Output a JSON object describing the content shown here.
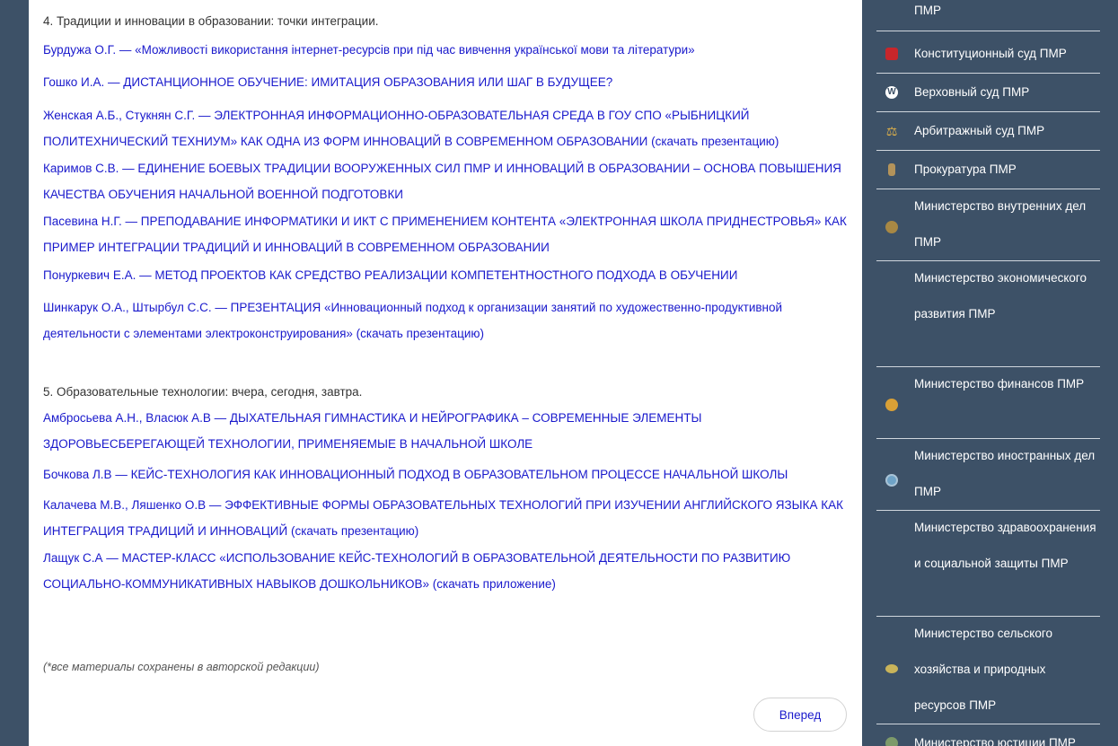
{
  "main": {
    "section4": {
      "heading": "4. Традиции и инновации в образовании: точки интеграции.",
      "links": [
        "Бурдужа О.Г. — «Можливості використання інтернет-ресурсів при під час вивчення української мови та літератури»",
        "Гошко И.А. — ДИСТАНЦИОННОЕ ОБУЧЕНИЕ: ИМИТАЦИЯ ОБРАЗОВАНИЯ ИЛИ ШАГ В БУДУЩЕЕ?",
        "Женская А.Б., Стукнян С.Г. — ЭЛЕКТРОННАЯ ИНФОРМАЦИОННО-ОБРАЗОВАТЕЛЬНАЯ СРЕДА В ГОУ СПО «РЫБНИЦКИЙ ПОЛИТЕХНИЧЕСКИЙ ТЕХНИУМ» КАК ОДНА ИЗ ФОРМ ИННОВАЦИЙ В СОВРЕМЕННОМ ОБРАЗОВАНИИ (скачать презентацию)",
        "Каримов С.В. — ЕДИНЕНИЕ БОЕВЫХ ТРАДИЦИИ ВООРУЖЕННЫХ СИЛ ПМР И ИННОВАЦИЙ В ОБРАЗОВАНИИ – ОСНОВА ПОВЫШЕНИЯ КАЧЕСТВА ОБУЧЕНИЯ НАЧАЛЬНОЙ ВОЕННОЙ ПОДГОТОВКИ",
        "Пасевина Н.Г. — ПРЕПОДАВАНИЕ ИНФОРМАТИКИ И ИКТ С ПРИМЕНЕНИЕМ КОНТЕНТА «ЭЛЕКТРОННАЯ ШКОЛА ПРИДНЕСТРОВЬЯ» КАК ПРИМЕР ИНТЕГРАЦИИ ТРАДИЦИЙ И ИННОВАЦИЙ В СОВРЕМЕННОМ ОБРАЗОВАНИИ",
        "Понуркевич Е.А. — МЕТОД ПРОЕКТОВ КАК СРЕДСТВО РЕАЛИЗАЦИИ КОМПЕТЕНТНОСТНОГО ПОДХОДА В ОБУЧЕНИИ",
        "Шинкарук О.А., Штырбул С.С. — ПРЕЗЕНТАЦИЯ «Инновационный подход к организации занятий по художественно-продуктивной деятельности с элементами электроконструирования» (скачать презентацию)"
      ]
    },
    "section5": {
      "heading": "5. Образовательные технологии: вчера, сегодня, завтра.",
      "links": [
        "Амбросьева А.Н., Власюк А.В — ДЫХАТЕЛЬНАЯ ГИМНАСТИКА И НЕЙРОГРАФИКА – СОВРЕМЕННЫЕ ЭЛЕМЕНТЫ ЗДОРОВЬЕСБЕРЕГАЮЩЕЙ ТЕХНОЛОГИИ, ПРИМЕНЯЕМЫЕ В НАЧАЛЬНОЙ ШКОЛЕ",
        "Бочкова Л.В — КЕЙС-ТЕХНОЛОГИЯ КАК ИННОВАЦИОННЫЙ ПОДХОД В ОБРАЗОВАТЕЛЬНОМ ПРОЦЕССЕ НАЧАЛЬНОЙ ШКОЛЫ",
        "Калачева М.В., Ляшенко О.В — ЭФФЕКТИВНЫЕ ФОРМЫ ОБРАЗОВАТЕЛЬНЫХ ТЕХНОЛОГИЙ ПРИ ИЗУЧЕНИИ АНГЛИЙСКОГО ЯЗЫКА КАК ИНТЕГРАЦИЯ ТРАДИЦИЙ И ИННОВАЦИЙ (скачать презентацию)",
        "Лащук С.А — МАСТЕР-КЛАСС «ИСПОЛЬЗОВАНИЕ КЕЙС-ТЕХНОЛОГИЙ В ОБРАЗОВАТЕЛЬНОЙ ДЕЯТЕЛЬНОСТИ ПО РАЗВИТИЮ СОЦИАЛЬНО-КОММУНИКАТИВНЫХ НАВЫКОВ ДОШКОЛЬНИКОВ» (скачать приложение)"
      ]
    },
    "note": "(*все материалы сохранены в авторской редакции)",
    "next_button": "Вперед"
  },
  "sidebar": {
    "items": [
      {
        "label": "ПМР",
        "icon": "none"
      },
      {
        "label": "Конституционный суд ПМР",
        "icon": "constitutional-court-emblem-icon"
      },
      {
        "label": "Верховный суд ПМР",
        "icon": "wordpress-icon"
      },
      {
        "label": "Арбитражный суд ПМР",
        "icon": "scales-icon"
      },
      {
        "label": "Прокуратура ПМР",
        "icon": "prosecutor-emblem-icon"
      },
      {
        "label": "Министерство внутренних дел ПМР",
        "icon": "interior-ministry-emblem-icon"
      },
      {
        "label": "Министерство экономического развития ПМР",
        "icon": "none"
      },
      {
        "label": "Министерство финансов ПМР",
        "icon": "finance-ministry-emblem-icon"
      },
      {
        "label": "Министерство иностранных дел ПМР",
        "icon": "foreign-ministry-emblem-icon"
      },
      {
        "label": "Министерство здравоохранения и социальной защиты ПМР",
        "icon": "none"
      },
      {
        "label": "Министерство сельского хозяйства и природных ресурсов ПМР",
        "icon": "agriculture-ministry-emblem-icon"
      },
      {
        "label": "Министерство юстиции ПМР",
        "icon": "justice-ministry-emblem-icon"
      }
    ]
  },
  "colors": {
    "link": "#1919cc",
    "sidebar_bg": "#3d5167",
    "text": "#333333"
  }
}
